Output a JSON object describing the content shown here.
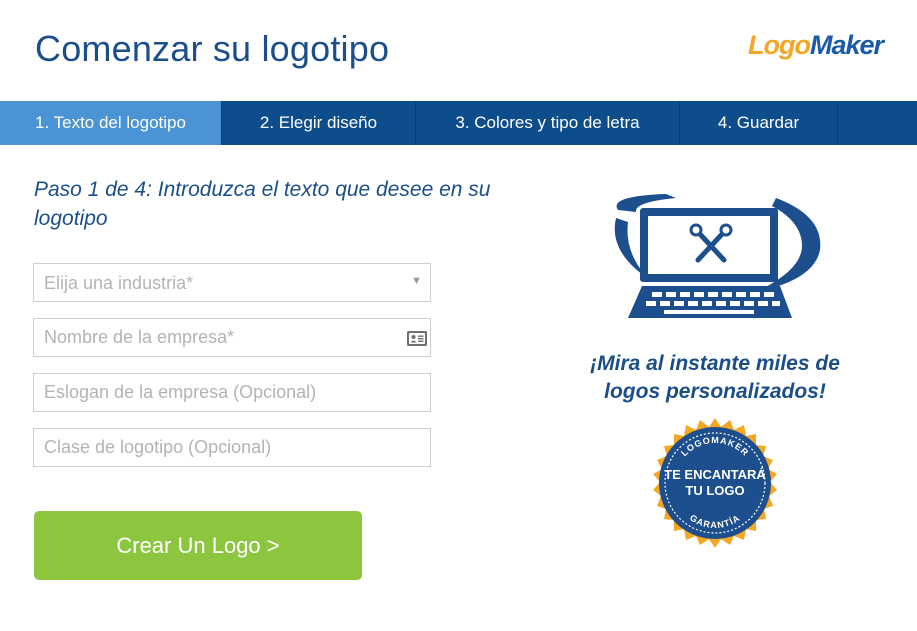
{
  "header": {
    "title": "Comenzar su logotipo",
    "brand_part1": "Logo",
    "brand_part2": "Maker"
  },
  "tabs": [
    {
      "label": "1. Texto del logotipo",
      "active": true
    },
    {
      "label": "2. Elegir diseño",
      "active": false
    },
    {
      "label": "3. Colores y tipo de letra",
      "active": false
    },
    {
      "label": "4. Guardar",
      "active": false
    }
  ],
  "form": {
    "step_title": "Paso 1 de 4: Introduzca el texto que desee en su logotipo",
    "industry_placeholder": "Elija una industria*",
    "company_placeholder": "Nombre de la empresa*",
    "slogan_placeholder": "Eslogan de la empresa (Opcional)",
    "logo_class_placeholder": "Clase de logotipo (Opcional)",
    "submit_label": "Crear Un Logo >"
  },
  "promo": {
    "headline": "¡Mira al instante miles de logos personalizados!",
    "badge_top": "LOGOMAKER",
    "badge_line1": "TE ENCANTARÁ",
    "badge_line2": "TU LOGO",
    "badge_bottom": "GARANTÍA"
  },
  "colors": {
    "brand_blue": "#1a4f8a",
    "tab_bar": "#0d4d8c",
    "tab_active": "#4a93d4",
    "cta_green": "#8cc63f",
    "brand_orange": "#f5a623",
    "badge_gold": "#f5a623"
  },
  "icons": {
    "select_caret": "caret-down-icon",
    "company_field": "id-card-icon",
    "hero_illustration": "computer-tools-icon",
    "badge": "guarantee-badge-icon"
  }
}
